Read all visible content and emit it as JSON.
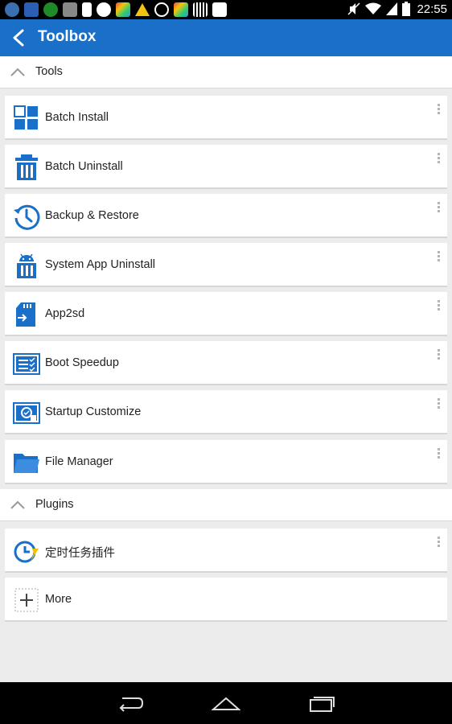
{
  "status_bar": {
    "time": "22:55",
    "left_icons": [
      "network-4g-icon",
      "wrench-icon",
      "game-icon",
      "battery-app-icon",
      "sim-card-icon",
      "steam-icon",
      "gallery-icon",
      "warning-icon",
      "g-refresh-icon",
      "gallery-icon-2",
      "barcode-icon",
      "bag-icon"
    ],
    "right_icons": [
      "mute-icon",
      "wifi-icon",
      "signal-icon",
      "battery-icon"
    ]
  },
  "app_bar": {
    "title": "Toolbox",
    "color": "#1a6fc9"
  },
  "sections": {
    "tools": {
      "label": "Tools",
      "items": [
        {
          "label": "Batch Install",
          "icon": "batch-install-icon"
        },
        {
          "label": "Batch Uninstall",
          "icon": "trash-icon"
        },
        {
          "label": "Backup & Restore",
          "icon": "clock-history-icon"
        },
        {
          "label": "System App Uninstall",
          "icon": "android-trash-icon"
        },
        {
          "label": "App2sd",
          "icon": "sd-card-icon"
        },
        {
          "label": "Boot Speedup",
          "icon": "checklist-icon"
        },
        {
          "label": "Startup Customize",
          "icon": "startup-gear-icon"
        },
        {
          "label": "File Manager",
          "icon": "folder-icon"
        }
      ]
    },
    "plugins": {
      "label": "Plugins",
      "items": [
        {
          "label": "定时任务插件",
          "icon": "timer-plugin-icon"
        },
        {
          "label": "More",
          "icon": "plus-icon"
        }
      ]
    }
  }
}
